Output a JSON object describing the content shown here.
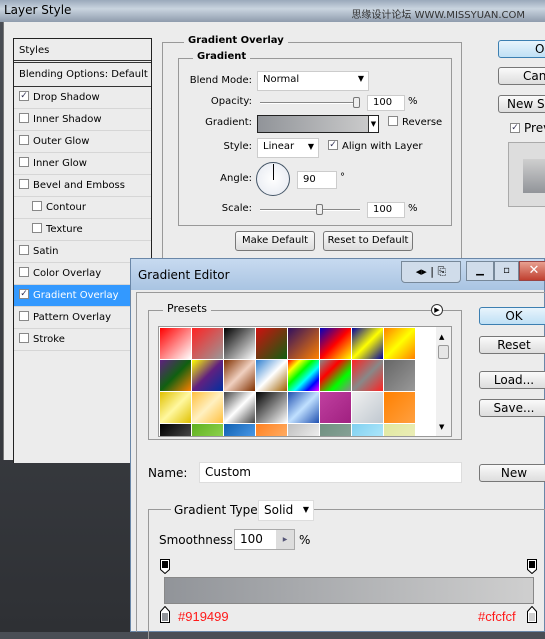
{
  "layer_style": {
    "title": "Layer Style",
    "watermark": "思缘设计论坛 WWW.MISSYUAN.COM",
    "styles_header": "Styles",
    "blending": "Blending Options: Default",
    "items": [
      {
        "label": "Drop Shadow",
        "checked": true,
        "indent": false
      },
      {
        "label": "Inner Shadow",
        "checked": false,
        "indent": false
      },
      {
        "label": "Outer Glow",
        "checked": false,
        "indent": false
      },
      {
        "label": "Inner Glow",
        "checked": false,
        "indent": false
      },
      {
        "label": "Bevel and Emboss",
        "checked": false,
        "indent": false
      },
      {
        "label": "Contour",
        "checked": false,
        "indent": true
      },
      {
        "label": "Texture",
        "checked": false,
        "indent": true
      },
      {
        "label": "Satin",
        "checked": false,
        "indent": false
      },
      {
        "label": "Color Overlay",
        "checked": false,
        "indent": false
      },
      {
        "label": "Gradient Overlay",
        "checked": true,
        "indent": false,
        "selected": true
      },
      {
        "label": "Pattern Overlay",
        "checked": false,
        "indent": false
      },
      {
        "label": "Stroke",
        "checked": false,
        "indent": false
      }
    ],
    "section": "Gradient Overlay",
    "subsection": "Gradient",
    "blend_mode_label": "Blend Mode:",
    "blend_mode": "Normal",
    "opacity_label": "Opacity:",
    "opacity": "100",
    "opacity_unit": "%",
    "gradient_label": "Gradient:",
    "reverse_label": "Reverse",
    "style_label": "Style:",
    "style": "Linear",
    "align_label": "Align with Layer",
    "angle_label": "Angle:",
    "angle": "90",
    "angle_unit": "°",
    "scale_label": "Scale:",
    "scale": "100",
    "scale_unit": "%",
    "make_default": "Make Default",
    "reset_default": "Reset to Default",
    "ok": "OK",
    "cancel": "Cancel",
    "new_style": "New Style...",
    "preview": "Preview"
  },
  "gradient_editor": {
    "title": "Gradient Editor",
    "presets_label": "Presets",
    "presets": [
      [
        "#ff0000",
        "#ffffff"
      ],
      [
        "#ff2222",
        "#999999"
      ],
      [
        "#000000",
        "#ffffff"
      ],
      [
        "#d01010",
        "#106010"
      ],
      [
        "#301060",
        "#ff8000"
      ],
      [
        "#0000c0",
        "#ff0000",
        "#ffff00"
      ],
      [
        "#0000a0",
        "#ffff00",
        "#0000a0"
      ],
      [
        "#ff8000",
        "#ffff00",
        "#ff8000"
      ],
      [
        "#602080",
        "#106010",
        "#ff8000"
      ],
      [
        "#ffff00",
        "#602080",
        "#0030a0"
      ],
      [
        "#803000",
        "#f0d0c0",
        "#803000"
      ],
      [
        "#3080d0",
        "#ffffff",
        "#a06000"
      ],
      [
        "#ff0000",
        "#ffff00",
        "#00ff00",
        "#00ffff",
        "#0000ff",
        "#ff00ff"
      ],
      [
        "#888888",
        "#ff0000",
        "#00ff00",
        "#888888"
      ],
      [
        "#ff2222",
        "#888888",
        "#ff2222"
      ],
      [
        "#666666",
        "#999999"
      ],
      [
        "#e0c000",
        "#fff8a0",
        "#e0c000"
      ],
      [
        "#ffc040",
        "#fff0c0",
        "#ffc040"
      ],
      [
        "#444444",
        "#ffffff",
        "#444444"
      ],
      [
        "#000000",
        "#ffffff"
      ],
      [
        "#2050b0",
        "#c0e0ff",
        "#2050b0"
      ],
      [
        "#c040a0",
        "#a02080"
      ],
      [
        "#f0f0f0",
        "#c0c8d0"
      ],
      [
        "#ff8000",
        "#ffa040"
      ],
      [
        "#000000",
        "#666666"
      ],
      [
        "#60b020",
        "#a0e060"
      ],
      [
        "#1060b0",
        "#60b0ff"
      ],
      [
        "#ff8020",
        "#ffc080"
      ],
      [
        "#c0c0c0",
        "#ffffff"
      ],
      [
        "#709080",
        "#90a8a0"
      ],
      [
        "#80d0f0",
        "#c0f0ff"
      ],
      [
        "#e0e8a0",
        "#f0f0c0"
      ]
    ],
    "ok": "OK",
    "reset": "Reset",
    "load": "Load...",
    "save": "Save...",
    "name_label": "Name:",
    "name": "Custom",
    "new": "New",
    "type_label": "Gradient Type:",
    "type": "Solid",
    "smoothness_label": "Smoothness:",
    "smoothness": "100",
    "smoothness_unit": "%",
    "start_color": "#919499",
    "end_color": "#cfcfcf",
    "start_label": "#919499",
    "end_label": "#cfcfcf"
  },
  "colors": {
    "accent": "#3399ff",
    "annotation": "#ff1a1a"
  }
}
